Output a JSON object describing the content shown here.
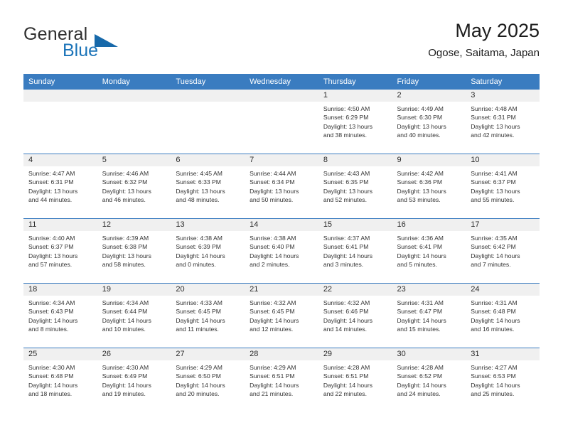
{
  "brand": {
    "word1": "General",
    "word2": "Blue",
    "logo_icon": "triangle-flag-icon",
    "accent_color": "#1769aa"
  },
  "header": {
    "title": "May 2025",
    "subtitle": "Ogose, Saitama, Japan"
  },
  "theme": {
    "header_blue": "#3a7cc0",
    "daynum_band": "#f0f0f0",
    "text": "#333333"
  },
  "columns": [
    "Sunday",
    "Monday",
    "Tuesday",
    "Wednesday",
    "Thursday",
    "Friday",
    "Saturday"
  ],
  "weeks": [
    [
      {
        "day": "",
        "sunrise": "",
        "sunset": "",
        "daylight1": "",
        "daylight2": "",
        "empty": true
      },
      {
        "day": "",
        "sunrise": "",
        "sunset": "",
        "daylight1": "",
        "daylight2": "",
        "empty": true
      },
      {
        "day": "",
        "sunrise": "",
        "sunset": "",
        "daylight1": "",
        "daylight2": "",
        "empty": true
      },
      {
        "day": "",
        "sunrise": "",
        "sunset": "",
        "daylight1": "",
        "daylight2": "",
        "empty": true
      },
      {
        "day": "1",
        "sunrise": "Sunrise: 4:50 AM",
        "sunset": "Sunset: 6:29 PM",
        "daylight1": "Daylight: 13 hours",
        "daylight2": "and 38 minutes."
      },
      {
        "day": "2",
        "sunrise": "Sunrise: 4:49 AM",
        "sunset": "Sunset: 6:30 PM",
        "daylight1": "Daylight: 13 hours",
        "daylight2": "and 40 minutes."
      },
      {
        "day": "3",
        "sunrise": "Sunrise: 4:48 AM",
        "sunset": "Sunset: 6:31 PM",
        "daylight1": "Daylight: 13 hours",
        "daylight2": "and 42 minutes."
      }
    ],
    [
      {
        "day": "4",
        "sunrise": "Sunrise: 4:47 AM",
        "sunset": "Sunset: 6:31 PM",
        "daylight1": "Daylight: 13 hours",
        "daylight2": "and 44 minutes."
      },
      {
        "day": "5",
        "sunrise": "Sunrise: 4:46 AM",
        "sunset": "Sunset: 6:32 PM",
        "daylight1": "Daylight: 13 hours",
        "daylight2": "and 46 minutes."
      },
      {
        "day": "6",
        "sunrise": "Sunrise: 4:45 AM",
        "sunset": "Sunset: 6:33 PM",
        "daylight1": "Daylight: 13 hours",
        "daylight2": "and 48 minutes."
      },
      {
        "day": "7",
        "sunrise": "Sunrise: 4:44 AM",
        "sunset": "Sunset: 6:34 PM",
        "daylight1": "Daylight: 13 hours",
        "daylight2": "and 50 minutes."
      },
      {
        "day": "8",
        "sunrise": "Sunrise: 4:43 AM",
        "sunset": "Sunset: 6:35 PM",
        "daylight1": "Daylight: 13 hours",
        "daylight2": "and 52 minutes."
      },
      {
        "day": "9",
        "sunrise": "Sunrise: 4:42 AM",
        "sunset": "Sunset: 6:36 PM",
        "daylight1": "Daylight: 13 hours",
        "daylight2": "and 53 minutes."
      },
      {
        "day": "10",
        "sunrise": "Sunrise: 4:41 AM",
        "sunset": "Sunset: 6:37 PM",
        "daylight1": "Daylight: 13 hours",
        "daylight2": "and 55 minutes."
      }
    ],
    [
      {
        "day": "11",
        "sunrise": "Sunrise: 4:40 AM",
        "sunset": "Sunset: 6:37 PM",
        "daylight1": "Daylight: 13 hours",
        "daylight2": "and 57 minutes."
      },
      {
        "day": "12",
        "sunrise": "Sunrise: 4:39 AM",
        "sunset": "Sunset: 6:38 PM",
        "daylight1": "Daylight: 13 hours",
        "daylight2": "and 58 minutes."
      },
      {
        "day": "13",
        "sunrise": "Sunrise: 4:38 AM",
        "sunset": "Sunset: 6:39 PM",
        "daylight1": "Daylight: 14 hours",
        "daylight2": "and 0 minutes."
      },
      {
        "day": "14",
        "sunrise": "Sunrise: 4:38 AM",
        "sunset": "Sunset: 6:40 PM",
        "daylight1": "Daylight: 14 hours",
        "daylight2": "and 2 minutes."
      },
      {
        "day": "15",
        "sunrise": "Sunrise: 4:37 AM",
        "sunset": "Sunset: 6:41 PM",
        "daylight1": "Daylight: 14 hours",
        "daylight2": "and 3 minutes."
      },
      {
        "day": "16",
        "sunrise": "Sunrise: 4:36 AM",
        "sunset": "Sunset: 6:41 PM",
        "daylight1": "Daylight: 14 hours",
        "daylight2": "and 5 minutes."
      },
      {
        "day": "17",
        "sunrise": "Sunrise: 4:35 AM",
        "sunset": "Sunset: 6:42 PM",
        "daylight1": "Daylight: 14 hours",
        "daylight2": "and 7 minutes."
      }
    ],
    [
      {
        "day": "18",
        "sunrise": "Sunrise: 4:34 AM",
        "sunset": "Sunset: 6:43 PM",
        "daylight1": "Daylight: 14 hours",
        "daylight2": "and 8 minutes."
      },
      {
        "day": "19",
        "sunrise": "Sunrise: 4:34 AM",
        "sunset": "Sunset: 6:44 PM",
        "daylight1": "Daylight: 14 hours",
        "daylight2": "and 10 minutes."
      },
      {
        "day": "20",
        "sunrise": "Sunrise: 4:33 AM",
        "sunset": "Sunset: 6:45 PM",
        "daylight1": "Daylight: 14 hours",
        "daylight2": "and 11 minutes."
      },
      {
        "day": "21",
        "sunrise": "Sunrise: 4:32 AM",
        "sunset": "Sunset: 6:45 PM",
        "daylight1": "Daylight: 14 hours",
        "daylight2": "and 12 minutes."
      },
      {
        "day": "22",
        "sunrise": "Sunrise: 4:32 AM",
        "sunset": "Sunset: 6:46 PM",
        "daylight1": "Daylight: 14 hours",
        "daylight2": "and 14 minutes."
      },
      {
        "day": "23",
        "sunrise": "Sunrise: 4:31 AM",
        "sunset": "Sunset: 6:47 PM",
        "daylight1": "Daylight: 14 hours",
        "daylight2": "and 15 minutes."
      },
      {
        "day": "24",
        "sunrise": "Sunrise: 4:31 AM",
        "sunset": "Sunset: 6:48 PM",
        "daylight1": "Daylight: 14 hours",
        "daylight2": "and 16 minutes."
      }
    ],
    [
      {
        "day": "25",
        "sunrise": "Sunrise: 4:30 AM",
        "sunset": "Sunset: 6:48 PM",
        "daylight1": "Daylight: 14 hours",
        "daylight2": "and 18 minutes."
      },
      {
        "day": "26",
        "sunrise": "Sunrise: 4:30 AM",
        "sunset": "Sunset: 6:49 PM",
        "daylight1": "Daylight: 14 hours",
        "daylight2": "and 19 minutes."
      },
      {
        "day": "27",
        "sunrise": "Sunrise: 4:29 AM",
        "sunset": "Sunset: 6:50 PM",
        "daylight1": "Daylight: 14 hours",
        "daylight2": "and 20 minutes."
      },
      {
        "day": "28",
        "sunrise": "Sunrise: 4:29 AM",
        "sunset": "Sunset: 6:51 PM",
        "daylight1": "Daylight: 14 hours",
        "daylight2": "and 21 minutes."
      },
      {
        "day": "29",
        "sunrise": "Sunrise: 4:28 AM",
        "sunset": "Sunset: 6:51 PM",
        "daylight1": "Daylight: 14 hours",
        "daylight2": "and 22 minutes."
      },
      {
        "day": "30",
        "sunrise": "Sunrise: 4:28 AM",
        "sunset": "Sunset: 6:52 PM",
        "daylight1": "Daylight: 14 hours",
        "daylight2": "and 24 minutes."
      },
      {
        "day": "31",
        "sunrise": "Sunrise: 4:27 AM",
        "sunset": "Sunset: 6:53 PM",
        "daylight1": "Daylight: 14 hours",
        "daylight2": "and 25 minutes."
      }
    ]
  ]
}
